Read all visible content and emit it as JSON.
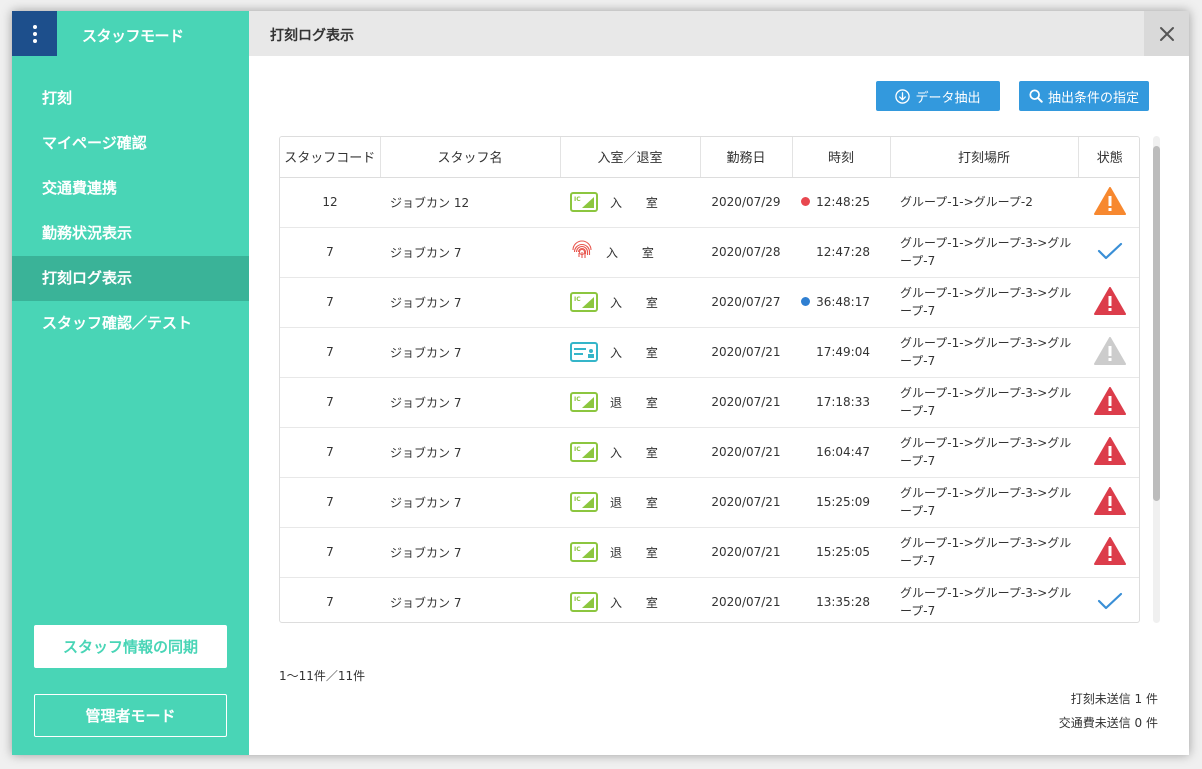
{
  "sidebar": {
    "title": "スタッフモード",
    "items": [
      {
        "label": "打刻",
        "active": false
      },
      {
        "label": "マイページ確認",
        "active": false
      },
      {
        "label": "交通費連携",
        "active": false
      },
      {
        "label": "勤務状況表示",
        "active": false
      },
      {
        "label": "打刻ログ表示",
        "active": true
      },
      {
        "label": "スタッフ確認／テスト",
        "active": false
      }
    ],
    "sync_label": "スタッフ情報の同期",
    "admin_label": "管理者モード"
  },
  "header": {
    "title": "打刻ログ表示"
  },
  "toolbar": {
    "export_label": "データ抽出",
    "filter_label": "抽出条件の指定"
  },
  "table": {
    "headers": [
      "スタッフコード",
      "スタッフ名",
      "入室／退室",
      "勤務日",
      "時刻",
      "打刻場所",
      "状態"
    ],
    "rows": [
      {
        "code": "12",
        "name": "ジョブカン 12",
        "method": "ic-card",
        "inout": "入 室",
        "date": "2020/07/29",
        "time": "12:48:25",
        "dot": "#e8474f",
        "place": "グループ-1->グループ-2",
        "status": "warning-orange"
      },
      {
        "code": "7",
        "name": "ジョブカン 7",
        "method": "fingerprint",
        "inout": "入 室",
        "date": "2020/07/28",
        "time": "12:47:28",
        "dot": "",
        "place": "グループ-1->グループ-3->グループ-7",
        "status": "check"
      },
      {
        "code": "7",
        "name": "ジョブカン 7",
        "method": "ic-card",
        "inout": "入 室",
        "date": "2020/07/27",
        "time": "36:48:17",
        "dot": "#2f7fd1",
        "place": "グループ-1->グループ-3->グループ-7",
        "status": "warning-red"
      },
      {
        "code": "7",
        "name": "ジョブカン 7",
        "method": "id-card",
        "inout": "入 室",
        "date": "2020/07/21",
        "time": "17:49:04",
        "dot": "",
        "place": "グループ-1->グループ-3->グループ-7",
        "status": "warning-gray"
      },
      {
        "code": "7",
        "name": "ジョブカン 7",
        "method": "ic-card",
        "inout": "退 室",
        "date": "2020/07/21",
        "time": "17:18:33",
        "dot": "",
        "place": "グループ-1->グループ-3->グループ-7",
        "status": "warning-red"
      },
      {
        "code": "7",
        "name": "ジョブカン 7",
        "method": "ic-card",
        "inout": "入 室",
        "date": "2020/07/21",
        "time": "16:04:47",
        "dot": "",
        "place": "グループ-1->グループ-3->グループ-7",
        "status": "warning-red"
      },
      {
        "code": "7",
        "name": "ジョブカン 7",
        "method": "ic-card",
        "inout": "退 室",
        "date": "2020/07/21",
        "time": "15:25:09",
        "dot": "",
        "place": "グループ-1->グループ-3->グループ-7",
        "status": "warning-red"
      },
      {
        "code": "7",
        "name": "ジョブカン 7",
        "method": "ic-card",
        "inout": "退 室",
        "date": "2020/07/21",
        "time": "15:25:05",
        "dot": "",
        "place": "グループ-1->グループ-3->グループ-7",
        "status": "warning-red"
      },
      {
        "code": "7",
        "name": "ジョブカン 7",
        "method": "ic-card",
        "inout": "入 室",
        "date": "2020/07/21",
        "time": "13:35:28",
        "dot": "",
        "place": "グループ-1->グループ-3->グループ-7",
        "status": "check"
      }
    ]
  },
  "footer": {
    "count_text": "1〜11件／11件",
    "unsent_punch": "打刻未送信 1 件",
    "unsent_transport": "交通費未送信 0 件"
  },
  "colors": {
    "sidebar_bg": "#49d5b6",
    "sidebar_active": "#3ab398",
    "menu_btn": "#1d4f8c",
    "button_blue": "#3399dd",
    "warning_red": "#dc3d4b",
    "warning_orange": "#f7882f",
    "warning_gray": "#cccccc",
    "check_blue": "#3a8fd6",
    "ic_green": "#8cc63f"
  }
}
